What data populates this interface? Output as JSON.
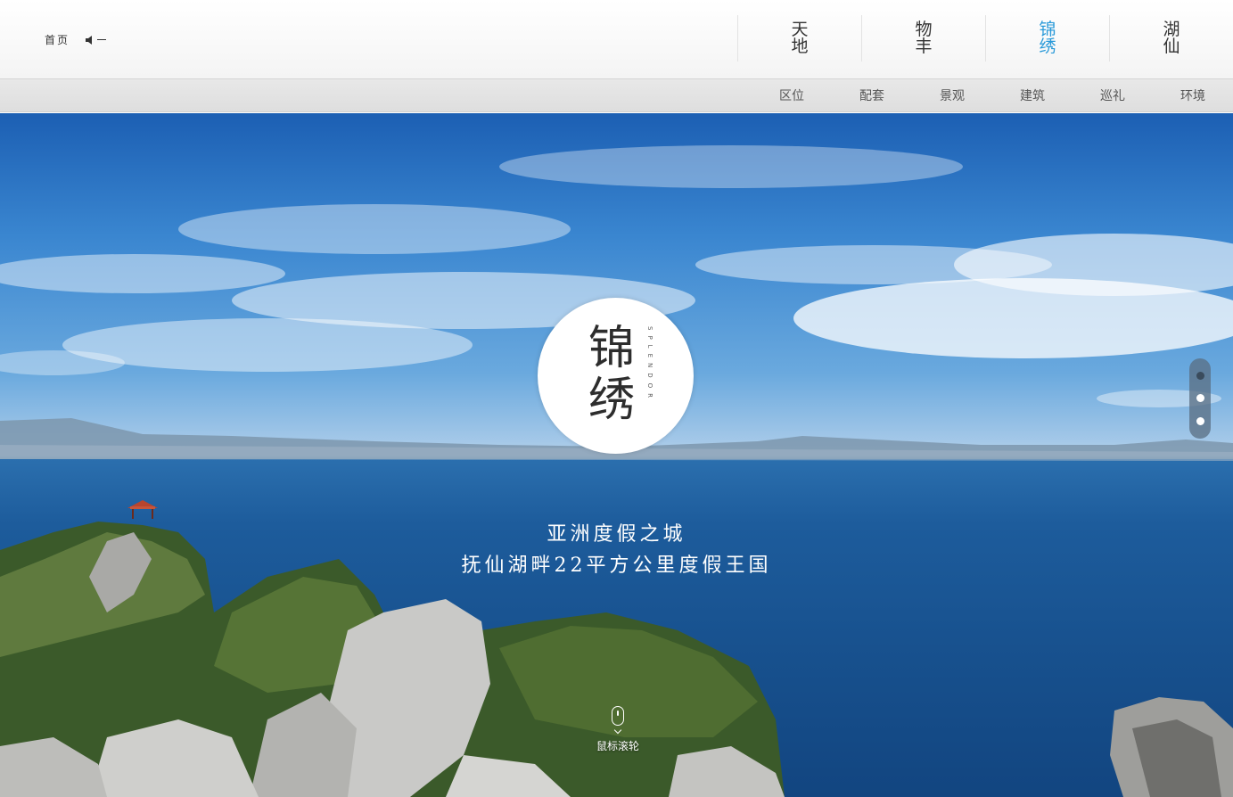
{
  "header": {
    "home_label": "首页",
    "main_nav": [
      {
        "label_top": "天",
        "label_bottom": "地",
        "active": false
      },
      {
        "label_top": "物",
        "label_bottom": "丰",
        "active": false
      },
      {
        "label_top": "锦",
        "label_bottom": "绣",
        "active": true
      },
      {
        "label_top": "湖",
        "label_bottom": "仙",
        "active": false
      }
    ]
  },
  "sub_nav": {
    "items": [
      "区位",
      "配套",
      "景观",
      "建筑",
      "巡礼",
      "环境"
    ]
  },
  "hero": {
    "logo": {
      "char_top": "锦",
      "char_bottom": "绣",
      "subtitle": "SPLENDOR"
    },
    "tagline_line1": "亚洲度假之城",
    "tagline_line2": "抚仙湖畔22平方公里度假王国",
    "slide_count": 3,
    "active_slide": 1,
    "scroll_label": "鼠标滚轮"
  },
  "icons": {
    "sound": "speaker-icon",
    "mouse": "mouse-icon",
    "chevron": "chevron-down-icon"
  }
}
